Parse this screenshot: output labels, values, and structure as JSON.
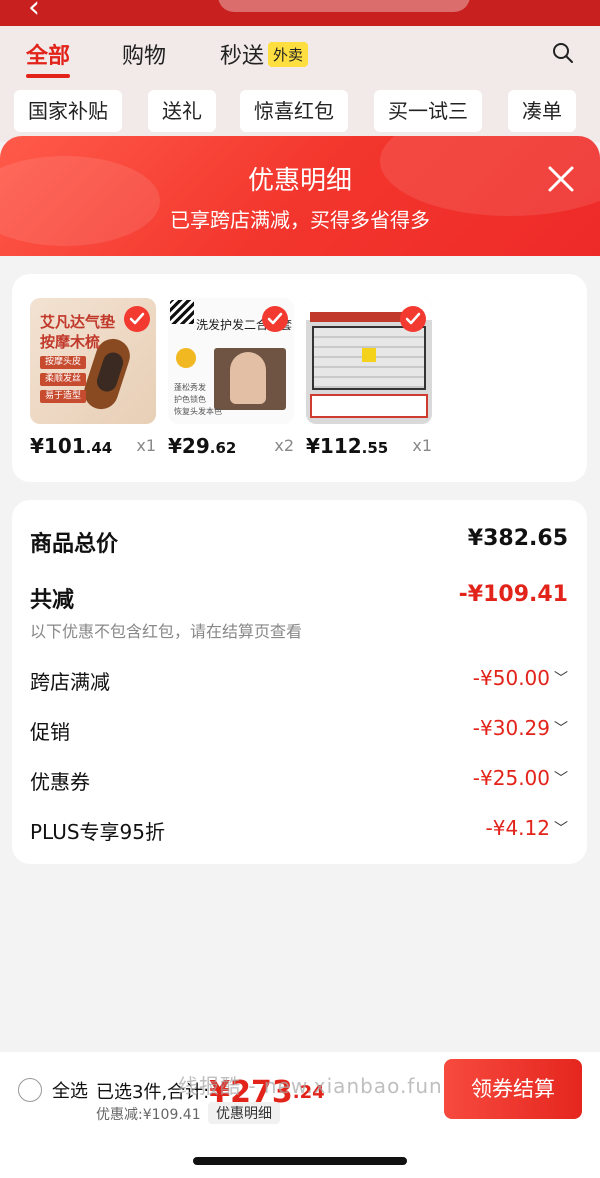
{
  "behind": {
    "tabs": [
      {
        "label": "全部",
        "active": true
      },
      {
        "label": "购物",
        "active": false
      },
      {
        "label": "秒送",
        "badge": "外卖",
        "active": false
      }
    ],
    "chips": [
      "国家补贴",
      "送礼",
      "惊喜红包",
      "买一试三",
      "凑单"
    ]
  },
  "sheet": {
    "title": "优惠明细",
    "subtitle": "已享跨店满减，买得多省得多"
  },
  "products": [
    {
      "price_int": "¥101",
      "price_dec": ".44",
      "qty": "x1",
      "thumb_text": "艾凡达气垫\n按摩木梳",
      "tags": [
        "按摩头皮",
        "柔顺发丝",
        "易于造型"
      ]
    },
    {
      "price_int": "¥29",
      "price_dec": ".62",
      "qty": "x2",
      "thumb_text": "洗发护发二合一套",
      "list": "蓬松秀发\n护色锁色\n恢复头发本色"
    },
    {
      "price_int": "¥112",
      "price_dec": ".55",
      "qty": "x1",
      "thumb_text": ""
    }
  ],
  "summary": {
    "total_label": "商品总价",
    "total_value": "¥382.65",
    "reduce_label": "共减",
    "reduce_value": "-¥109.41",
    "note": "以下优惠不包含红包，请在结算页查看",
    "items": [
      {
        "label": "跨店满减",
        "value": "-¥50.00"
      },
      {
        "label": "促销",
        "value": "-¥30.29"
      },
      {
        "label": "优惠券",
        "value": "-¥25.00"
      },
      {
        "label": "PLUS专享95折",
        "value": "-¥4.12"
      }
    ]
  },
  "bottom": {
    "select_all": "全选",
    "selected_text": "已选3件,合计:",
    "amount_int": "¥273",
    "amount_dec": ".24",
    "discount_text": "优惠减:¥109.41",
    "detail_label": "优惠明细",
    "checkout": "领券结算",
    "watermark": "线报酷 - new.xianbao.fun"
  },
  "colors": {
    "accent": "#e2231a",
    "header": "#f3362d"
  }
}
